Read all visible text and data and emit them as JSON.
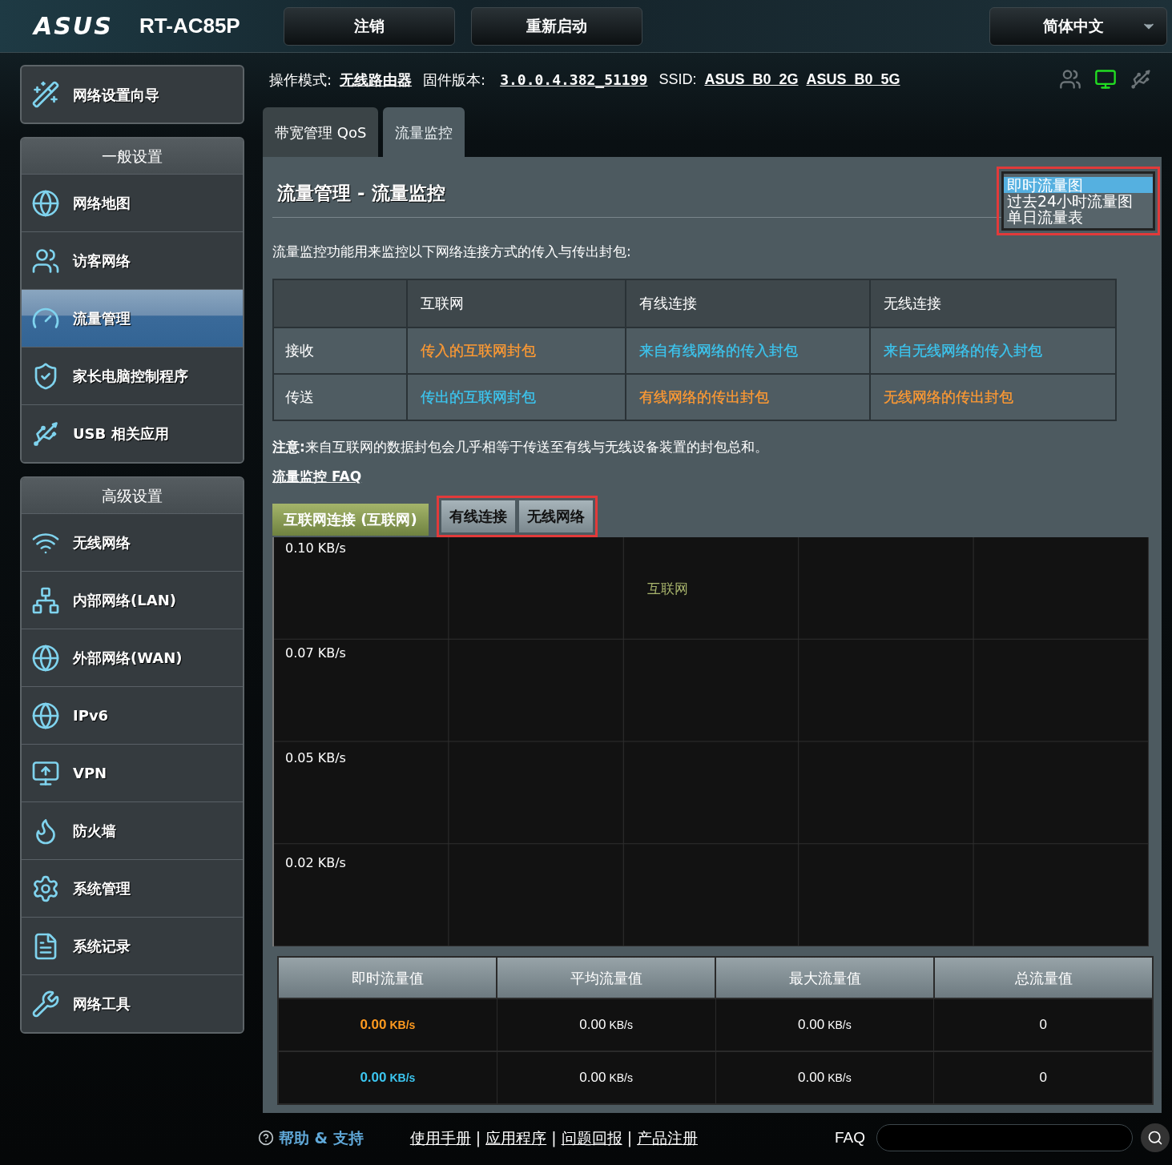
{
  "header": {
    "logo": "ASUS",
    "model": "RT-AC85P",
    "buttons": [
      "注销",
      "重新启动"
    ],
    "language": "简体中文"
  },
  "status": {
    "op_mode_label": "操作模式:",
    "op_mode": "无线路由器",
    "firmware_label": "固件版本:",
    "firmware": "3.0.0.4.382_51199",
    "ssid_label": "SSID:",
    "ssids": [
      "ASUS_B0_2G",
      "ASUS_B0_5G"
    ],
    "network_connected": true
  },
  "sidebar": {
    "wizard": {
      "label": "网络设置向导",
      "kind": "wizard"
    },
    "sections": [
      {
        "title": "一般设置",
        "items": [
          {
            "label": "网络地图",
            "kind": "map",
            "selected": false
          },
          {
            "label": "访客网络",
            "kind": "guest",
            "selected": false
          },
          {
            "label": "流量管理",
            "kind": "gauge",
            "selected": true
          },
          {
            "label": "家长电脑控制程序",
            "kind": "shield",
            "selected": false
          },
          {
            "label": "USB 相关应用",
            "kind": "usb",
            "selected": false
          }
        ]
      },
      {
        "title": "高级设置",
        "items": [
          {
            "label": "无线网络",
            "kind": "wireless",
            "selected": false
          },
          {
            "label": "内部网络(LAN)",
            "kind": "lan",
            "selected": false
          },
          {
            "label": "外部网络(WAN)",
            "kind": "globe",
            "selected": false
          },
          {
            "label": "IPv6",
            "kind": "ipv6",
            "selected": false
          },
          {
            "label": "VPN",
            "kind": "vpn",
            "selected": false
          },
          {
            "label": "防火墙",
            "kind": "firewall",
            "selected": false
          },
          {
            "label": "系统管理",
            "kind": "admin",
            "selected": false
          },
          {
            "label": "系统记录",
            "kind": "log",
            "selected": false
          },
          {
            "label": "网络工具",
            "kind": "tools",
            "selected": false
          }
        ]
      }
    ]
  },
  "tabs": [
    {
      "label": "带宽管理 QoS",
      "selected": false
    },
    {
      "label": "流量监控",
      "selected": true
    }
  ],
  "page": {
    "title": "流量管理 - 流量监控",
    "view_list": [
      {
        "label": "即时流量图",
        "selected": true
      },
      {
        "label": "过去24小时流量图",
        "selected": false
      },
      {
        "label": "单日流量表",
        "selected": false
      }
    ],
    "description": "流量监控功能用来监控以下网络连接方式的传入与传出封包:",
    "table": {
      "columns": [
        "互联网",
        "有线连接",
        "无线连接"
      ],
      "rows": [
        {
          "label": "接收",
          "cells": [
            {
              "text": "传入的互联网封包",
              "color": "#ff9a33"
            },
            {
              "text": "来自有线网络的传入封包",
              "color": "#3cc6f0"
            },
            {
              "text": "来自无线网络的传入封包",
              "color": "#3cc6f0"
            }
          ]
        },
        {
          "label": "传送",
          "cells": [
            {
              "text": "传出的互联网封包",
              "color": "#3cc6f0"
            },
            {
              "text": "有线网络的传出封包",
              "color": "#ff9a33"
            },
            {
              "text": "无线网络的传出封包",
              "color": "#ff9a33"
            }
          ]
        }
      ]
    },
    "note": "**注意:**来自互联网的数据封包会几乎相等于传送至有线与无线设备装置的封包总和。",
    "faq_link": "流量监控 FAQ",
    "graph_tabs": [
      {
        "label": "互联网连接 (互联网)",
        "selected": true
      },
      {
        "label": "有线连接",
        "selected": false
      },
      {
        "label": "无线网络",
        "selected": false
      }
    ],
    "graph": {
      "y_labels": [
        "0.10 KB/s",
        "0.07 KB/s",
        "0.05 KB/s",
        "0.02 KB/s"
      ],
      "legend": "互联网"
    },
    "stats": {
      "columns": [
        "即时流量值",
        "平均流量值",
        "最大流量值",
        "总流量值"
      ],
      "rows": [
        {
          "color": "#ff9a1f",
          "current": {
            "value": "0.00",
            "unit": "KB/s"
          },
          "average": {
            "value": "0.00",
            "unit": "KB/s"
          },
          "max": {
            "value": "0.00",
            "unit": "KB/s"
          },
          "total": "0"
        },
        {
          "color": "#3cc6f0",
          "current": {
            "value": "0.00",
            "unit": "KB/s"
          },
          "average": {
            "value": "0.00",
            "unit": "KB/s"
          },
          "max": {
            "value": "0.00",
            "unit": "KB/s"
          },
          "total": "0"
        }
      ]
    }
  },
  "footer": {
    "help": "帮助 & 支持",
    "links": [
      "使用手册",
      "应用程序",
      "问题回报",
      "产品注册"
    ],
    "separator": "|",
    "faq": "FAQ"
  }
}
